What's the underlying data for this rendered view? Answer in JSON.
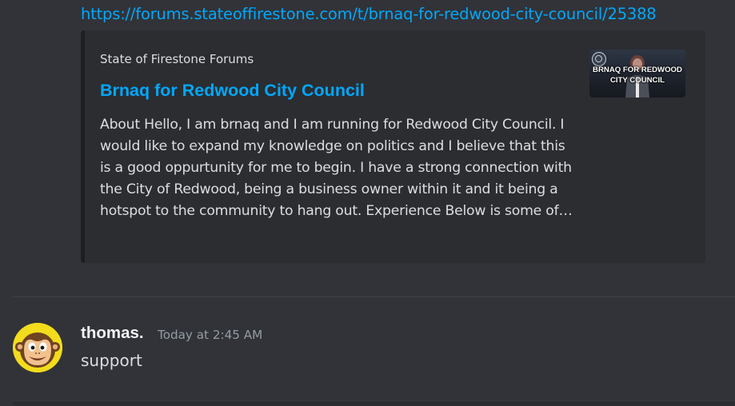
{
  "colors": {
    "background": "#313338",
    "embed_background": "#2b2d31",
    "link": "#00a8fc",
    "text": "#dbdee1",
    "muted": "#949ba4",
    "username": "#f2f3f5",
    "avatar_background": "#f2dc1c"
  },
  "link": {
    "url": "https://forums.stateoffirestone.com/t/brnaq-for-redwood-city-council/25388"
  },
  "embed": {
    "provider": "State of Firestone Forums",
    "title": "Brnaq for Redwood City Council",
    "description": "About Hello, I am brnaq and I am running for Redwood City Council. I would like to expand my knowledge on politics and I believe that this is a good oppurtunity for me to begin. I have a strong connection with the City of Redwood, being a business owner within it and it being a hotspot to the community to hang out. Experience Below is some of…",
    "thumbnail_text": "BRNAQ FOR REDWOOD\nCITY COUNCIL"
  },
  "message": {
    "username": "thomas.",
    "timestamp": "Today at 2:45 AM",
    "content": "support",
    "avatar_icon": "curious-george-avatar-icon"
  }
}
